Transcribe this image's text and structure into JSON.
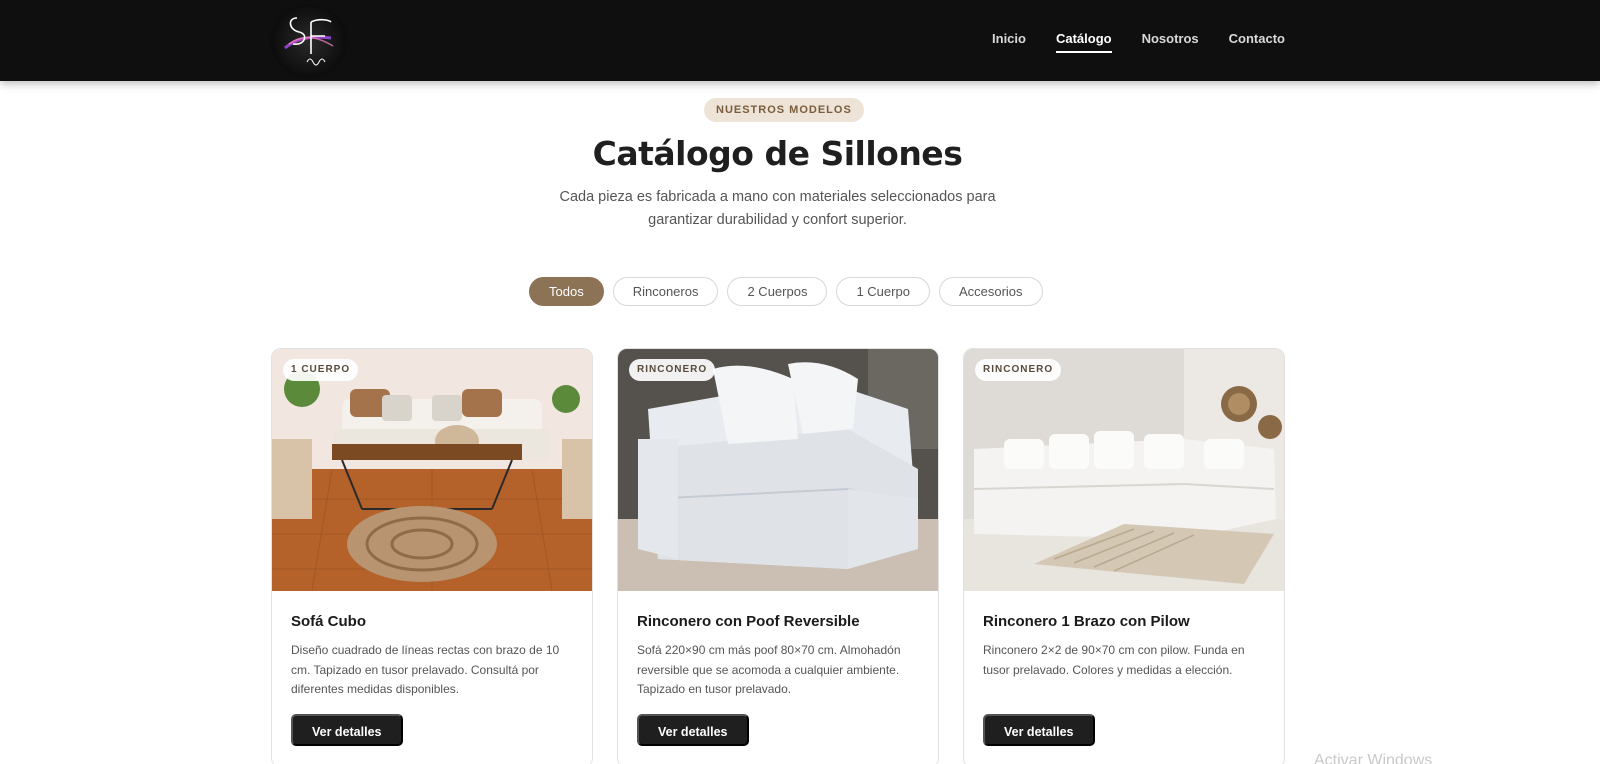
{
  "brand": {
    "logo_alt": "SF living."
  },
  "nav": {
    "items": [
      {
        "label": "Inicio",
        "active": false
      },
      {
        "label": "Catálogo",
        "active": true
      },
      {
        "label": "Nosotros",
        "active": false
      },
      {
        "label": "Contacto",
        "active": false
      }
    ]
  },
  "hero": {
    "eyebrow": "NUESTROS MODELOS",
    "title": "Catálogo de Sillones",
    "subtitle": "Cada pieza es fabricada a mano con materiales seleccionados para garantizar durabilidad y confort superior."
  },
  "filters": {
    "items": [
      {
        "label": "Todos",
        "active": true
      },
      {
        "label": "Rinconeros",
        "active": false
      },
      {
        "label": "2 Cuerpos",
        "active": false
      },
      {
        "label": "1 Cuerpo",
        "active": false
      },
      {
        "label": "Accesorios",
        "active": false
      }
    ]
  },
  "products": [
    {
      "badge": "1 CUERPO",
      "title": "Sofá Cubo",
      "description": "Diseño cuadrado de líneas rectas con brazo de 10 cm. Tapizado en tusor prelavado. Consultá por diferentes medidas disponibles.",
      "button": "Ver detalles"
    },
    {
      "badge": "RINCONERO",
      "title": "Rinconero con Poof Reversible",
      "description": "Sofá 220×90 cm más poof 80×70 cm. Almohadón reversible que se acomoda a cualquier ambiente. Tapizado en tusor prelavado.",
      "button": "Ver detalles"
    },
    {
      "badge": "RINCONERO",
      "title": "Rinconero 1 Brazo con Pilow",
      "description": "Rinconero 2×2 de 90×70 cm con pilow. Funda en tusor prelavado. Colores y medidas a elección.",
      "button": "Ver detalles"
    }
  ],
  "os_watermark": "Activar Windows",
  "colors": {
    "navbar_bg": "#0f0f0f",
    "accent": "#8c7356",
    "eyebrow_bg": "#ede3d6",
    "button_dark": "#1f1f1f"
  }
}
